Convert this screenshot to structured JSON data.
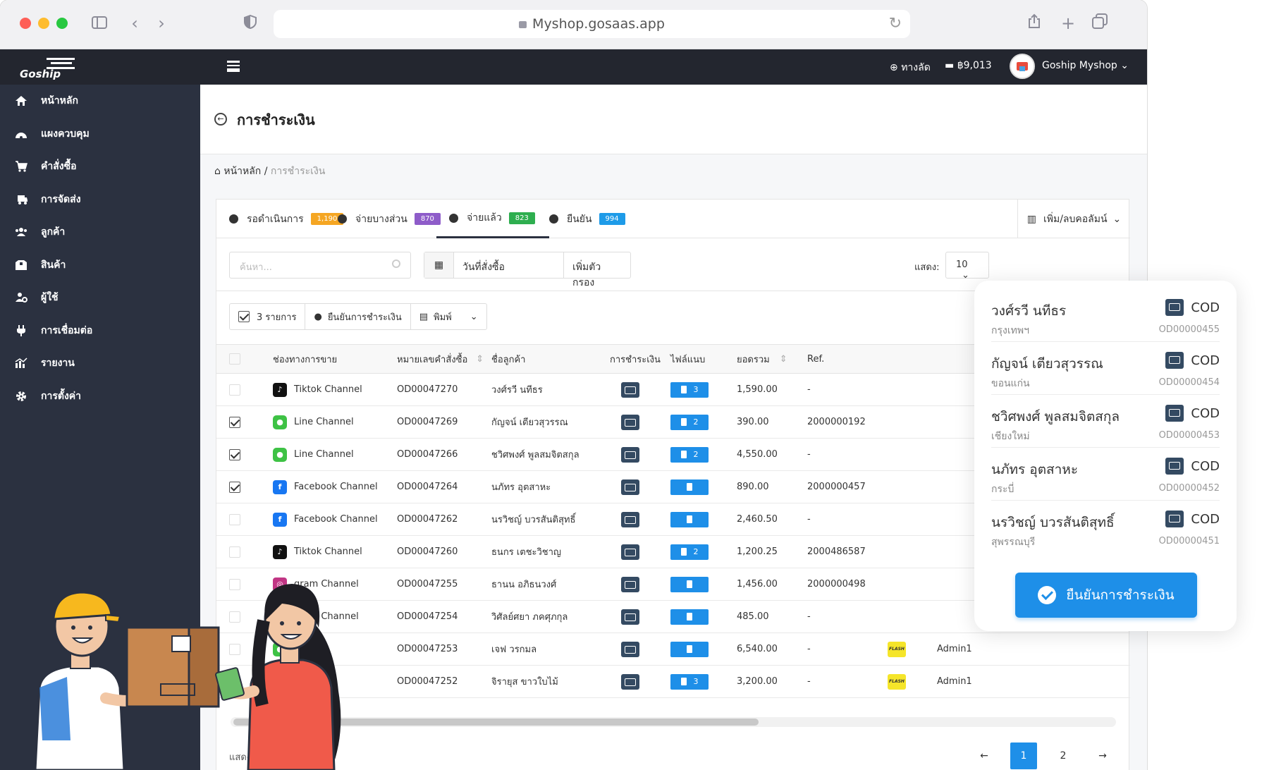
{
  "browser": {
    "url": "Myshop.gosaas.app"
  },
  "brand": {
    "logo_text": "Goship"
  },
  "sidebar": {
    "items": [
      {
        "label": "หน้าหลัก",
        "icon": "home-icon"
      },
      {
        "label": "แผงควบคุม",
        "icon": "dashboard-icon"
      },
      {
        "label": "คำสั่งซื้อ",
        "icon": "cart-icon"
      },
      {
        "label": "การจัดส่ง",
        "icon": "delivery-icon"
      },
      {
        "label": "ลูกค้า",
        "icon": "users-icon"
      },
      {
        "label": "สินค้า",
        "icon": "box-icon"
      },
      {
        "label": "ผู้ใช้",
        "icon": "user-gear-icon"
      },
      {
        "label": "การเชื่อมต่อ",
        "icon": "plug-icon"
      },
      {
        "label": "รายงาน",
        "icon": "chart-icon"
      },
      {
        "label": "การตั้งค่า",
        "icon": "gear-icon"
      }
    ]
  },
  "topbar": {
    "shortcut": "ทางลัด",
    "balance": "฿9,013",
    "shop": "Goship Myshop"
  },
  "page": {
    "title": "การชำระเงิน",
    "breadcrumb_home": "หน้าหลัก",
    "breadcrumb_current": "การชำระเงิน"
  },
  "tabs": [
    {
      "label": "รอดำเนินการ",
      "count": "1,190",
      "color": "#f5a623"
    },
    {
      "label": "จ่ายบางส่วน",
      "count": "870",
      "color": "#8e5cc9"
    },
    {
      "label": "จ่ายแล้ว",
      "count": "823",
      "color": "#2eae4f"
    },
    {
      "label": "ยืนยัน",
      "count": "994",
      "color": "#1e9be8"
    }
  ],
  "columns_button": "เพิ่ม/ลบคอลัมน์",
  "filters": {
    "search_placeholder": "ค้นหา...",
    "date_label": "วันที่สั่งซื้อ",
    "add_filter": "เพิ่มตัวกรอง",
    "show_label": "แสดง:",
    "show_value": "10"
  },
  "bulk": {
    "selected": "3 รายการ",
    "confirm": "ยืนยันการชำระเงิน",
    "print": "พิมพ์"
  },
  "table": {
    "headers": {
      "channel": "ช่องทางการขาย",
      "order_no": "หมายเลขคำสั่งซื้อ",
      "customer": "ชื่อลูกค้า",
      "payment": "การชำระเงิน",
      "attach": "ไฟล์แนบ",
      "total": "ยอดรวม",
      "ref": "Ref."
    },
    "rows": [
      {
        "checked": false,
        "channel": "Tiktok Channel",
        "ch": "tiktok",
        "order": "OD00047270",
        "customer": "วงศ์รวี นทีธร",
        "files": "3",
        "total": "1,590.00",
        "ref": "-",
        "carrier": "",
        "admin": ""
      },
      {
        "checked": true,
        "channel": "Line Channel",
        "ch": "line",
        "order": "OD00047269",
        "customer": "กัญจน์ เตียวสุวรรณ",
        "files": "2",
        "total": "390.00",
        "ref": "2000000192",
        "carrier": "",
        "admin": ""
      },
      {
        "checked": true,
        "channel": "Line Channel",
        "ch": "line",
        "order": "OD00047266",
        "customer": "ชวิศพงศ์ พูลสมจิตสกุล",
        "files": "2",
        "total": "4,550.00",
        "ref": "-",
        "carrier": "",
        "admin": ""
      },
      {
        "checked": true,
        "channel": "Facebook Channel",
        "ch": "fb",
        "order": "OD00047264",
        "customer": "นภัทร อุตสาหะ",
        "files": "",
        "total": "890.00",
        "ref": "2000000457",
        "carrier": "",
        "admin": ""
      },
      {
        "checked": false,
        "channel": "Facebook Channel",
        "ch": "fb",
        "order": "OD00047262",
        "customer": "นรวิชญ์ บวรสันติสุทธิ์",
        "files": "",
        "total": "2,460.50",
        "ref": "-",
        "carrier": "",
        "admin": ""
      },
      {
        "checked": false,
        "channel": "Tiktok Channel",
        "ch": "tiktok",
        "order": "OD00047260",
        "customer": "ธนกร เตชะวิชาญ",
        "files": "2",
        "total": "1,200.25",
        "ref": "2000486587",
        "carrier": "",
        "admin": ""
      },
      {
        "checked": false,
        "channel": "gram Channel",
        "ch": "ig",
        "order": "OD00047255",
        "customer": "ธานน อภิธนวงศ์",
        "files": "",
        "total": "1,456.00",
        "ref": "2000000498",
        "carrier": "",
        "admin": ""
      },
      {
        "checked": false,
        "channel": "gram Channel",
        "ch": "ig",
        "order": "OD00047254",
        "customer": "วิศัลย์ศยา ภคศุภกุล",
        "files": "",
        "total": "485.00",
        "ref": "-",
        "carrier": "",
        "admin": ""
      },
      {
        "checked": false,
        "channel": "hannel",
        "ch": "line",
        "order": "OD00047253",
        "customer": "เจฟ วรกมล",
        "files": "",
        "total": "6,540.00",
        "ref": "-",
        "carrier": "FLASH",
        "admin": "Admin1"
      },
      {
        "checked": false,
        "channel": "nnel",
        "ch": "fb",
        "order": "OD00047252",
        "customer": "จิรายุส ขาวใบไม้",
        "files": "3",
        "total": "3,200.00",
        "ref": "-",
        "carrier": "FLASH",
        "admin": "Admin1"
      }
    ]
  },
  "footer": {
    "showing": "แสดง 1 ถึง 1"
  },
  "pager": {
    "prev": "←",
    "pages": [
      "1",
      "2"
    ],
    "next": "→"
  },
  "popup": {
    "items": [
      {
        "name": "วงศ์รวี นทีธร",
        "province": "กรุงเทพฯ",
        "method": "COD",
        "order": "OD00000455"
      },
      {
        "name": "กัญจน์ เตียวสุวรรณ",
        "province": "ขอนแก่น",
        "method": "COD",
        "order": "OD00000454"
      },
      {
        "name": "ชวิศพงศ์ พูลสมจิตสกุล",
        "province": "เชียงใหม่",
        "method": "COD",
        "order": "OD00000453"
      },
      {
        "name": "นภัทร อุตสาหะ",
        "province": "กระบี่",
        "method": "COD",
        "order": "OD00000452"
      },
      {
        "name": "นรวิชญ์ บวรสันติสุทธิ์",
        "province": "สุพรรณบุรี",
        "method": "COD",
        "order": "OD00000451"
      }
    ],
    "confirm": "ยืนยันการชำระเงิน"
  }
}
